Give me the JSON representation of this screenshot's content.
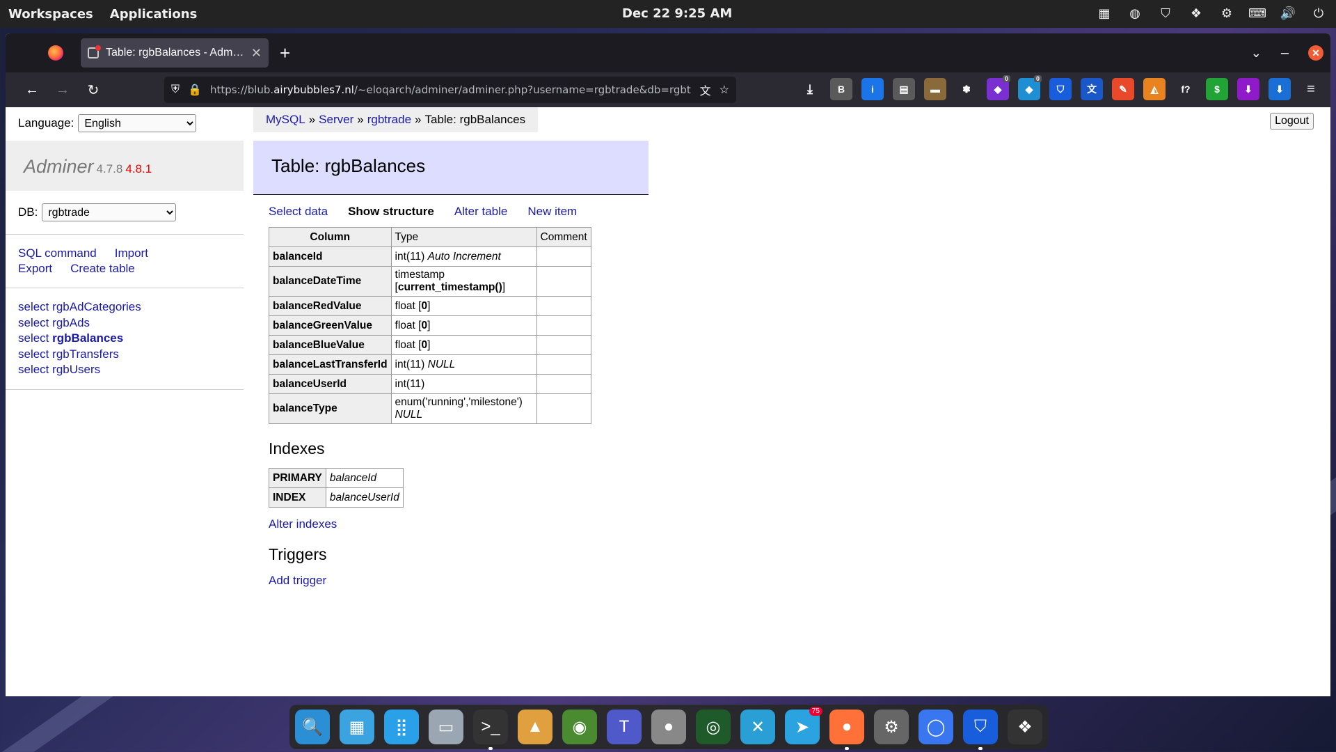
{
  "system_bar": {
    "workspaces": "Workspaces",
    "applications": "Applications",
    "clock": "Dec 22  9:25 AM"
  },
  "browser": {
    "tab_title": "Table: rgbBalances - Adminer",
    "url_prefix": "https://blub.",
    "url_domain": "airybubbles7.nl",
    "url_rest": "/~eloqarch/adminer/adminer.php?username=rgbtrade&db=rgbtrade&table=rgbBalances",
    "extensions": [
      {
        "icon": "b-circle-icon",
        "glyph": "B",
        "color": "#5a5a5a"
      },
      {
        "icon": "info-icon",
        "glyph": "i",
        "color": "#1b74e8"
      },
      {
        "icon": "reader-icon",
        "glyph": "▤",
        "color": "#5a5a5a"
      },
      {
        "icon": "folder-icon",
        "glyph": "▬",
        "color": "#8a6a3a"
      },
      {
        "icon": "paw-icon",
        "glyph": "✽",
        "color": "#2b2a33"
      },
      {
        "icon": "puzzle-purple-icon",
        "glyph": "◆",
        "color": "#7a2fd0",
        "badge": "0"
      },
      {
        "icon": "puzzle-blue-icon",
        "glyph": "◆",
        "color": "#1f8fd4",
        "badge": "0"
      },
      {
        "icon": "bitwarden-icon",
        "glyph": "⛉",
        "color": "#175ddc"
      },
      {
        "icon": "translate-icon",
        "glyph": "文",
        "color": "#1a57c9"
      },
      {
        "icon": "edit-icon",
        "glyph": "✎",
        "color": "#e8492b"
      },
      {
        "icon": "metamask-icon",
        "glyph": "◭",
        "color": "#e8831f"
      },
      {
        "icon": "function-icon",
        "glyph": "f?",
        "color": "#2b2a33"
      },
      {
        "icon": "money-icon",
        "glyph": "$",
        "color": "#21a336"
      },
      {
        "icon": "download-purple-icon",
        "glyph": "⬇",
        "color": "#8e1ac9"
      },
      {
        "icon": "download-blue-icon",
        "glyph": "⬇",
        "color": "#1a6fd6"
      }
    ]
  },
  "adminer": {
    "language_label": "Language:",
    "language_value": "English",
    "app_name": "Adminer",
    "version": "4.7.8",
    "new_version": "4.8.1",
    "db_label": "DB:",
    "db_value": "rgbtrade",
    "commands": [
      "SQL command",
      "Import",
      "Export",
      "Create table"
    ],
    "table_prefix": "select",
    "tables": [
      "rgbAdCategories",
      "rgbAds",
      "rgbBalances",
      "rgbTransfers",
      "rgbUsers"
    ],
    "active_table": "rgbBalances",
    "breadcrumb": {
      "mysql": "MySQL",
      "sep": "»",
      "server": "Server",
      "db": "rgbtrade",
      "current": "Table: rgbBalances"
    },
    "logout": "Logout",
    "heading": "Table: rgbBalances",
    "links": {
      "select_data": "Select data",
      "show_structure": "Show structure",
      "alter_table": "Alter table",
      "new_item": "New item"
    },
    "structure": {
      "headers": [
        "Column",
        "Type",
        "Comment"
      ],
      "rows": [
        {
          "column": "balanceId",
          "type": "int(11)",
          "extra": "Auto Increment",
          "default": ""
        },
        {
          "column": "balanceDateTime",
          "type": "timestamp",
          "extra": "",
          "default": "current_timestamp()"
        },
        {
          "column": "balanceRedValue",
          "type": "float",
          "extra": "",
          "default": "0"
        },
        {
          "column": "balanceGreenValue",
          "type": "float",
          "extra": "",
          "default": "0"
        },
        {
          "column": "balanceBlueValue",
          "type": "float",
          "extra": "",
          "default": "0"
        },
        {
          "column": "balanceLastTransferId",
          "type": "int(11)",
          "extra": "NULL",
          "default": ""
        },
        {
          "column": "balanceUserId",
          "type": "int(11)",
          "extra": "",
          "default": ""
        },
        {
          "column": "balanceType",
          "type": "enum('running','milestone')",
          "extra": "NULL",
          "default": ""
        }
      ]
    },
    "indexes_heading": "Indexes",
    "indexes": [
      {
        "type": "PRIMARY",
        "columns": "balanceId"
      },
      {
        "type": "INDEX",
        "columns": "balanceUserId"
      }
    ],
    "alter_indexes": "Alter indexes",
    "triggers_heading": "Triggers",
    "add_trigger": "Add trigger"
  },
  "dock": {
    "apps": [
      {
        "name": "search-app-icon",
        "glyph": "🔍",
        "color": "#2b8fd6"
      },
      {
        "name": "workspaces-app-icon",
        "glyph": "▦",
        "color": "#3aa3e0"
      },
      {
        "name": "app-grid-icon",
        "glyph": "⣿",
        "color": "#2aa0e8"
      },
      {
        "name": "files-app-icon",
        "glyph": "▭",
        "color": "#9aa6b2"
      },
      {
        "name": "terminal-app-icon",
        "glyph": ">_",
        "color": "#333",
        "running": true
      },
      {
        "name": "image-viewer-app-icon",
        "glyph": "▲",
        "color": "#e0a040"
      },
      {
        "name": "system-monitor-app-icon",
        "glyph": "◉",
        "color": "#4a8a30"
      },
      {
        "name": "teams-app-icon",
        "glyph": "T",
        "color": "#5059c9"
      },
      {
        "name": "disk-app-icon",
        "glyph": "●",
        "color": "#888"
      },
      {
        "name": "camera-app-icon",
        "glyph": "◎",
        "color": "#1f5a2a"
      },
      {
        "name": "remote-desktop-app-icon",
        "glyph": "✕",
        "color": "#2a9fd6"
      },
      {
        "name": "telegram-app-icon",
        "glyph": "➤",
        "color": "#2aa3e0",
        "badge": "75"
      },
      {
        "name": "firefox-app-icon",
        "glyph": "●",
        "color": "#ff7139",
        "running": true
      },
      {
        "name": "settings-app-icon",
        "glyph": "⚙",
        "color": "#666"
      },
      {
        "name": "signal-app-icon",
        "glyph": "◯",
        "color": "#3a76f0"
      },
      {
        "name": "bitwarden-app-icon",
        "glyph": "⛉",
        "color": "#175ddc",
        "running": true
      },
      {
        "name": "dropbox-app-icon",
        "glyph": "❖",
        "color": "#333"
      }
    ]
  }
}
